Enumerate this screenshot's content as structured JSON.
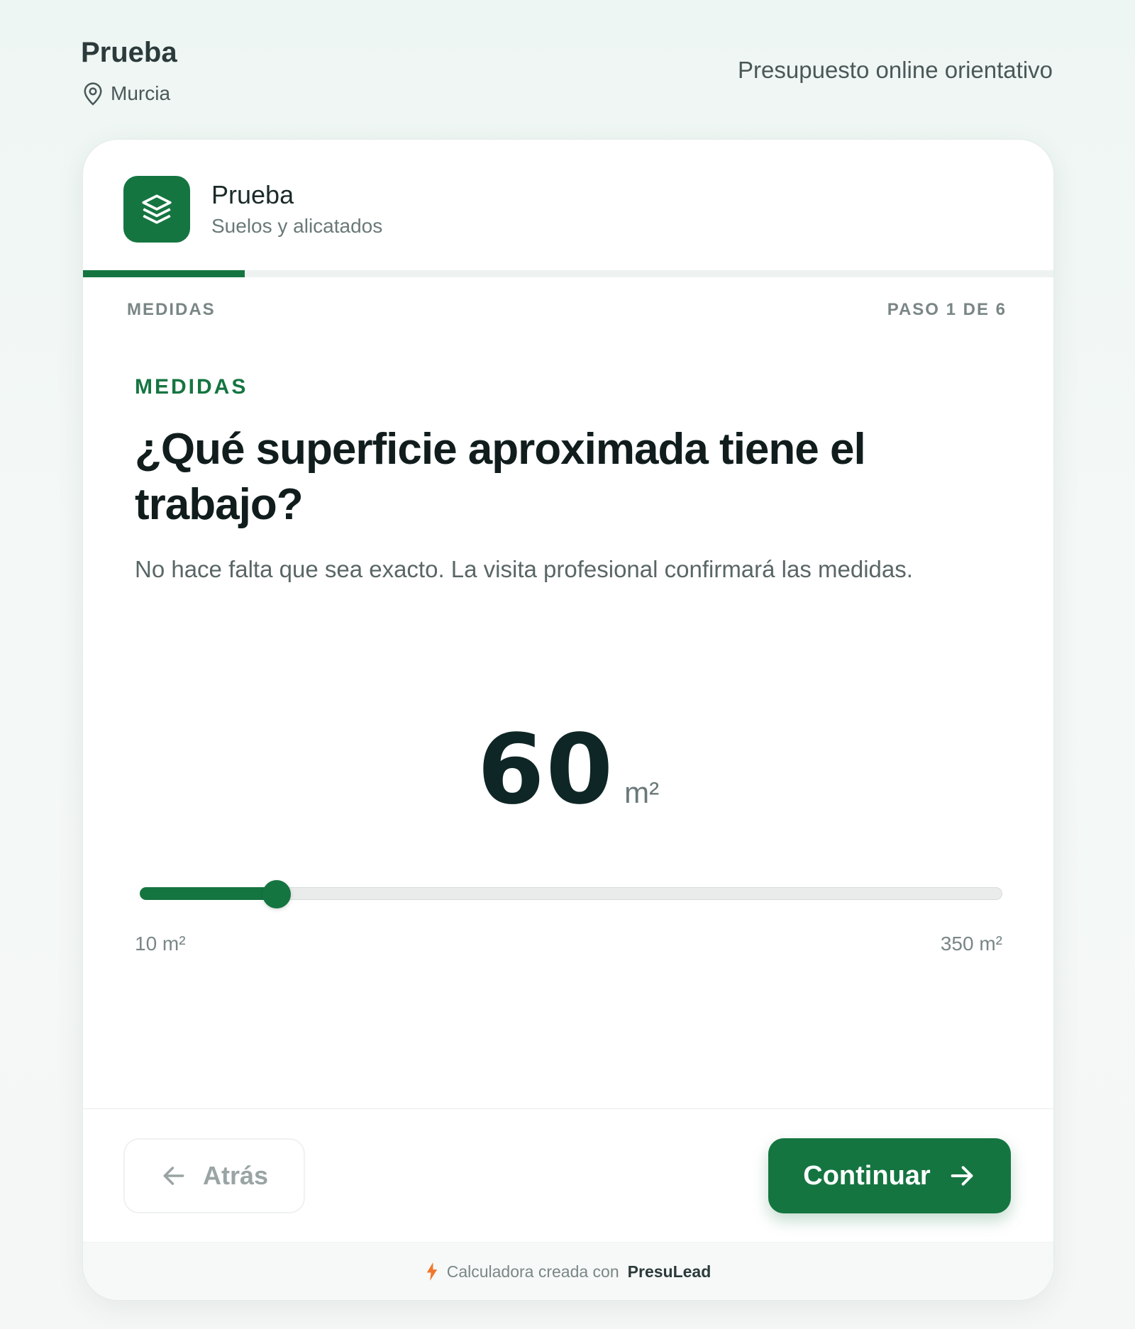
{
  "header": {
    "title": "Prueba",
    "location": "Murcia",
    "tagline": "Presupuesto online orientativo"
  },
  "card": {
    "app_name": "Prueba",
    "app_subtitle": "Suelos y alicatados",
    "progress_fraction": 0.1667,
    "step_name": "MEDIDAS",
    "step_counter": "PASO 1 DE 6",
    "question": {
      "eyebrow": "MEDIDAS",
      "title": "¿Qué superficie aproximada tiene el trabajo?",
      "help": "No hace falta que sea exacto. La visita profesional confirmará las medidas."
    },
    "slider": {
      "value": 60,
      "min": 10,
      "max": 350,
      "unit": "m²",
      "min_label": "10 m²",
      "max_label": "350 m²"
    },
    "buttons": {
      "back_label": "Atrás",
      "next_label": "Continuar"
    },
    "credit": {
      "prefix": "Calculadora creada con",
      "brand": "PresuLead"
    }
  },
  "colors": {
    "accent": "#157541",
    "bolt": "#f0772e"
  },
  "icons": {
    "location": "map-pin-icon",
    "app": "layers-icon",
    "back": "arrow-left-icon",
    "next": "arrow-right-icon",
    "credit": "bolt-icon"
  }
}
